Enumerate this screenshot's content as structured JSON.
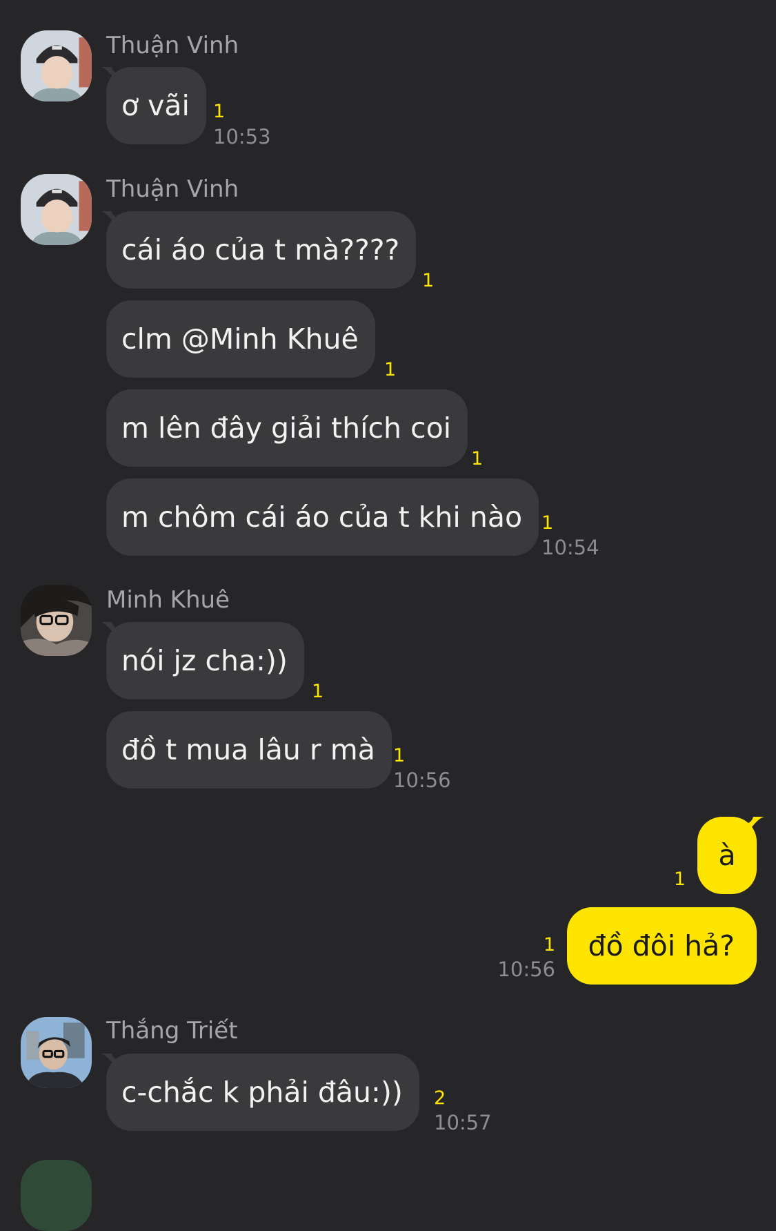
{
  "messages": [
    {
      "sender": "Thuận Vinh",
      "avatar": "avatar-thuan-vinh",
      "bubbles": [
        {
          "text": "ơ vãi",
          "unread": "1",
          "time": "10:53"
        }
      ]
    },
    {
      "sender": "Thuận Vinh",
      "avatar": "avatar-thuan-vinh",
      "bubbles": [
        {
          "text": "cái áo của t mà????",
          "unread": "1"
        },
        {
          "text": "clm @Minh Khuê",
          "unread": "1"
        },
        {
          "text": "m lên đây giải thích coi",
          "unread": "1"
        },
        {
          "text": "m chôm cái áo của t khi nào",
          "unread": "1",
          "time": "10:54"
        }
      ]
    },
    {
      "sender": "Minh Khuê",
      "avatar": "avatar-minh-khue",
      "bubbles": [
        {
          "text": "nói jz cha:))",
          "unread": "1"
        },
        {
          "text": "đồ t mua lâu r mà",
          "unread": "1",
          "time": "10:56"
        }
      ]
    },
    {
      "sender": "me",
      "bubbles": [
        {
          "text": "à",
          "unread": "1"
        },
        {
          "text": "đồ đôi hả?",
          "unread": "1",
          "time": "10:56"
        }
      ]
    },
    {
      "sender": "Thắng Triết",
      "avatar": "avatar-thang-triet",
      "bubbles": [
        {
          "text": "c-chắc k phải đâu:))",
          "unread": "2",
          "time": "10:57"
        }
      ]
    }
  ],
  "colors": {
    "background": "#262628",
    "incoming_bubble": "#3a3a3c",
    "outgoing_bubble": "#fee500",
    "unread_count": "#fee500",
    "timestamp": "#8e8e92",
    "sender_name": "#a6a6a8"
  }
}
